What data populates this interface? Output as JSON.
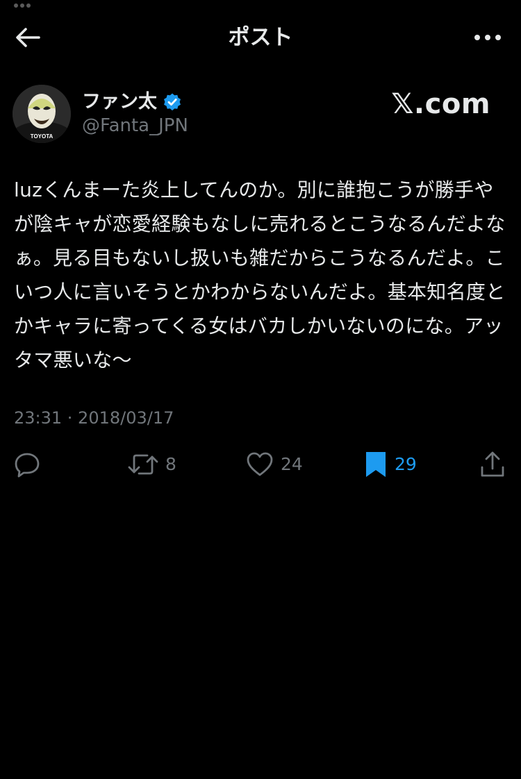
{
  "header": {
    "title": "ポスト",
    "back_icon": "back-arrow-icon",
    "more_icon": "more-horizontal-icon"
  },
  "author": {
    "display_name": "ファン太",
    "handle": "@Fanta_JPN",
    "verified": true,
    "avatar_badge_text": "TOYOTA"
  },
  "brand": "𝕏.com",
  "post": {
    "text": "luzくんまーた炎上してんのか。別に誰抱こうが勝手やが陰キャが恋愛経験もなしに売れるとこうなるんだよなぁ。見る目もないし扱いも雑だからこうなるんだよ。こいつ人に言いそうとかわからないんだよ。基本知名度とかキャラに寄ってくる女はバカしかいないのにな。アッタマ悪いな〜",
    "timestamp": "23:31 · 2018/03/17"
  },
  "actions": {
    "reply": {
      "icon": "reply-icon",
      "count": ""
    },
    "repost": {
      "icon": "repost-icon",
      "count": "8"
    },
    "like": {
      "icon": "heart-icon",
      "count": "24"
    },
    "bookmark": {
      "icon": "bookmark-icon",
      "count": "29",
      "active": true
    },
    "share": {
      "icon": "share-icon",
      "count": ""
    }
  },
  "colors": {
    "background": "#000000",
    "text_primary": "#e7e9ea",
    "text_secondary": "#71767b",
    "accent": "#1d9bf0"
  }
}
